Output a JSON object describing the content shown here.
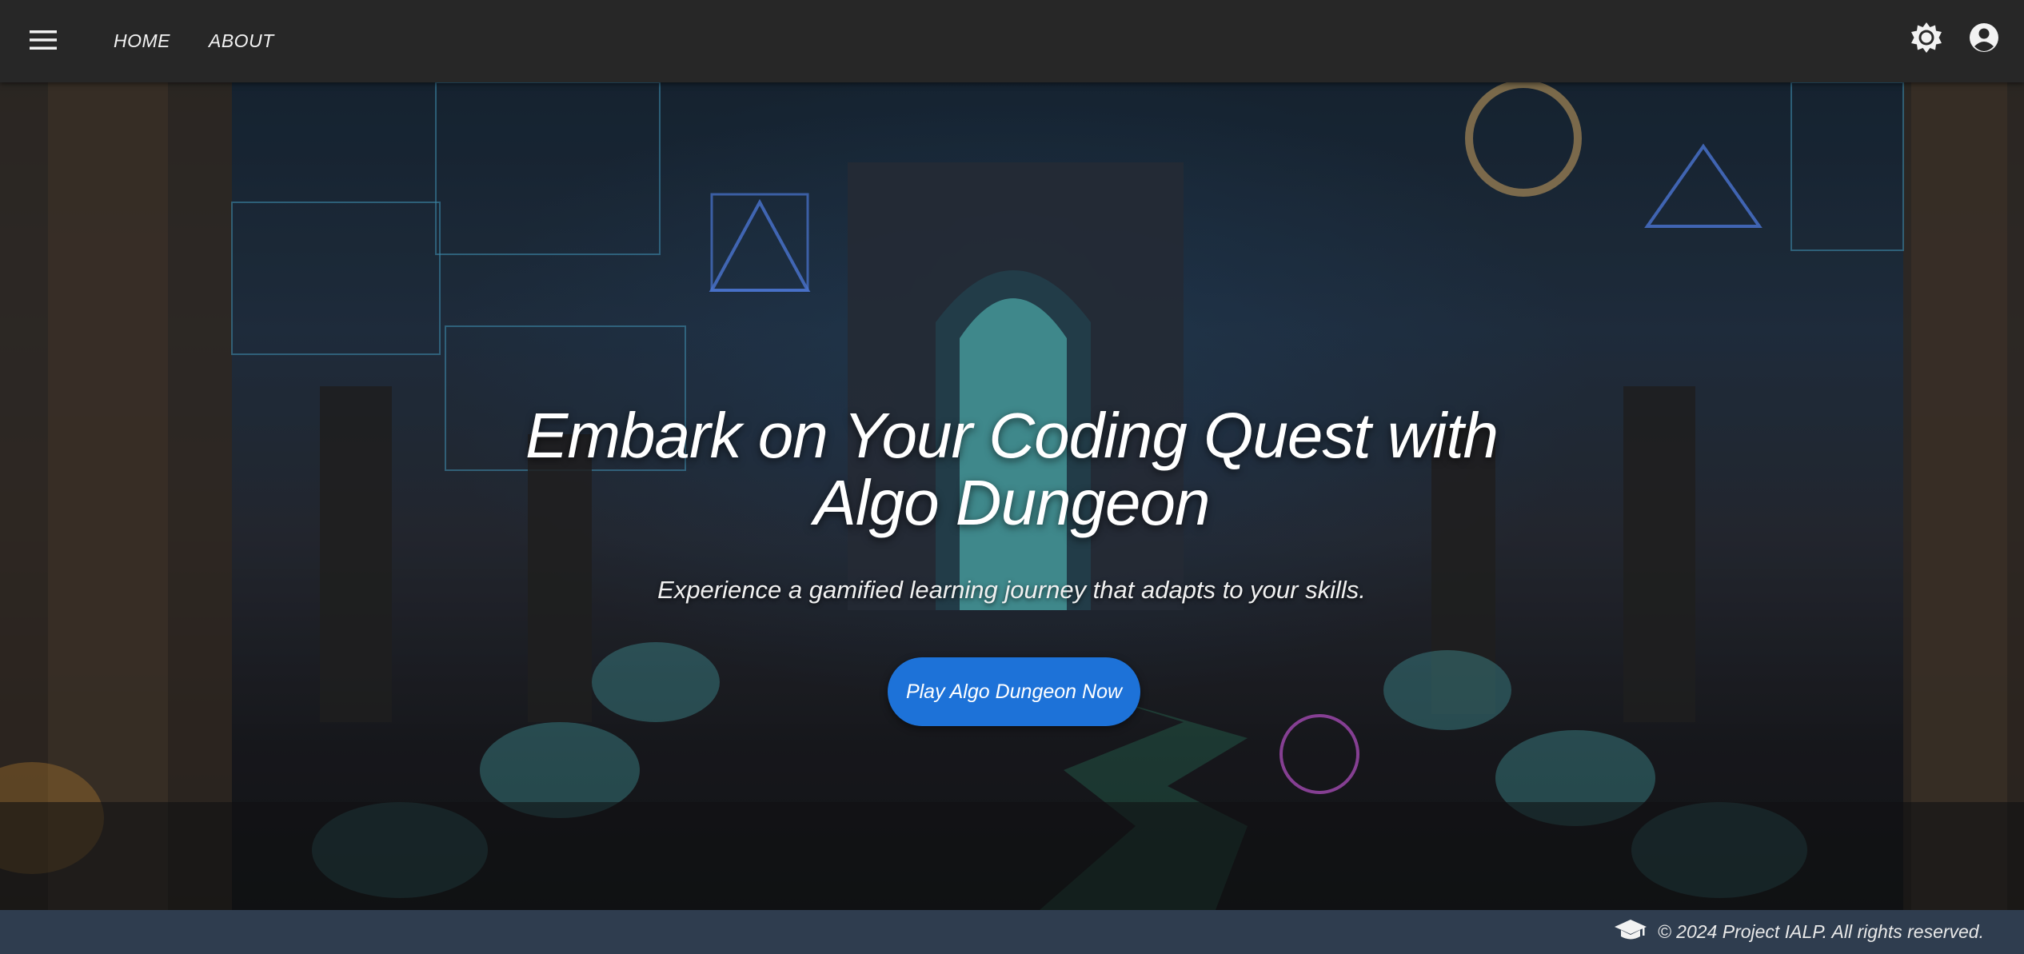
{
  "header": {
    "menu_icon": "hamburger-menu-icon",
    "nav": [
      {
        "label": "HOME"
      },
      {
        "label": "ABOUT"
      }
    ],
    "theme_icon": "brightness-icon",
    "account_icon": "account-circle-icon"
  },
  "hero": {
    "title_line1": "Embark on Your Coding Quest with",
    "title_line2": "Algo Dungeon",
    "subtitle": "Experience a gamified learning journey that adapts to your skills.",
    "cta_label": "Play Algo Dungeon Now",
    "background_image": "dungeon-portal-illustration"
  },
  "footer": {
    "icon": "graduation-cap-icon",
    "text": "© 2024 Project IALP. All rights reserved."
  },
  "colors": {
    "topbar": "#272727",
    "cta": "#1d72d8",
    "footer": "#2f3d4f"
  }
}
